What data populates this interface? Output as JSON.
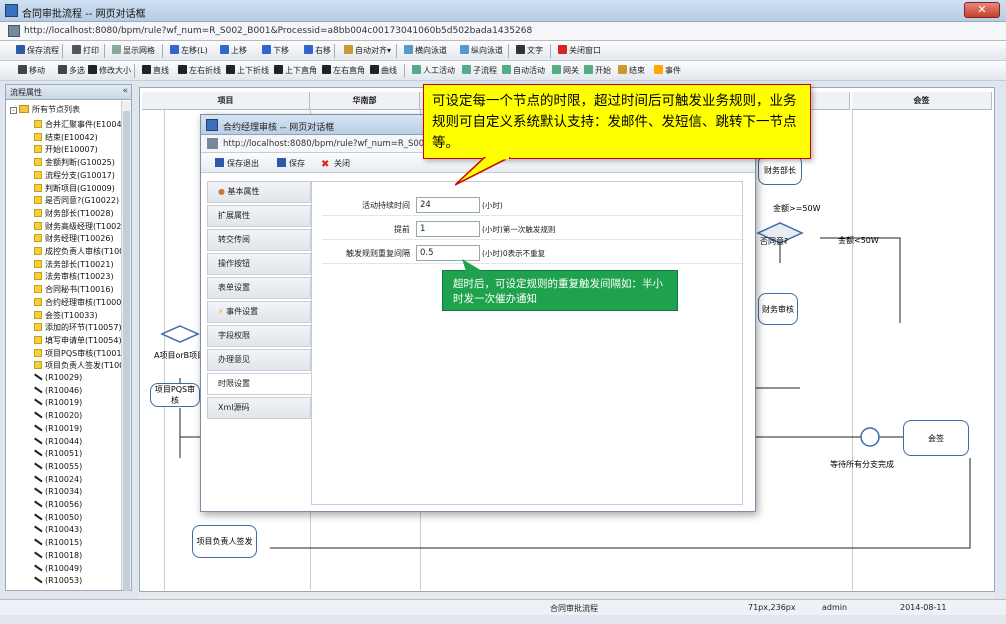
{
  "window": {
    "title": "合同审批流程 -- 网页对话框",
    "close": "✕",
    "url": "http://localhost:8080/bpm/rule?wf_num=R_S002_B001&Processid=a8bb004c00173041060b5d502bada1435268"
  },
  "toolbar1": [
    {
      "id": "save-flow",
      "label": "保存流程",
      "color": "#2d5aa8"
    },
    {
      "id": "print",
      "label": "打印",
      "color": "#555"
    },
    {
      "id": "show-grid",
      "label": "显示网格",
      "color": "#8a9"
    },
    {
      "id": "align-left",
      "label": "左移(L)",
      "color": "#36c"
    },
    {
      "id": "move-up",
      "label": "上移",
      "color": "#36c"
    },
    {
      "id": "move-down",
      "label": "下移",
      "color": "#36c"
    },
    {
      "id": "move-right",
      "label": "右移",
      "color": "#36c"
    },
    {
      "id": "auto-align",
      "label": "自动对齐▾",
      "color": "#c93"
    },
    {
      "id": "h-lane",
      "label": "横向泳道",
      "color": "#59c"
    },
    {
      "id": "v-lane",
      "label": "纵向泳道",
      "color": "#59c"
    },
    {
      "id": "text",
      "label": "文字",
      "color": "#333"
    },
    {
      "id": "close-window",
      "label": "关闭窗口",
      "color": "#d22"
    }
  ],
  "toolbar2": [
    {
      "id": "move",
      "label": "移动",
      "color": "#444"
    },
    {
      "id": "multi-select",
      "label": "多选",
      "color": "#444"
    },
    {
      "id": "resize",
      "label": "修改大小",
      "color": "#222"
    },
    {
      "id": "line",
      "label": "直线",
      "color": "#222"
    },
    {
      "id": "left-fold",
      "label": "左右折线",
      "color": "#222"
    },
    {
      "id": "ud-fold",
      "label": "上下折线",
      "color": "#222"
    },
    {
      "id": "ud-right",
      "label": "上下直角",
      "color": "#222"
    },
    {
      "id": "lr-right",
      "label": "左右直角",
      "color": "#222"
    },
    {
      "id": "curve",
      "label": "曲线",
      "color": "#222"
    },
    {
      "id": "manual-activity",
      "label": "人工活动",
      "color": "#5a8"
    },
    {
      "id": "sub-flow",
      "label": "子流程",
      "color": "#5a8"
    },
    {
      "id": "auto-activity",
      "label": "自动活动",
      "color": "#5a8"
    },
    {
      "id": "gateway",
      "label": "网关",
      "color": "#5a8"
    },
    {
      "id": "start",
      "label": "开始",
      "color": "#5a8"
    },
    {
      "id": "end",
      "label": "结束",
      "color": "#c93"
    },
    {
      "id": "event",
      "label": "事件",
      "color": "#fa0"
    }
  ],
  "left_panel": {
    "title": "流程属性",
    "collapse": "«",
    "root": "所有节点列表",
    "nodes": [
      {
        "t": "act",
        "label": "合并汇聚事件(E10045"
      },
      {
        "t": "act",
        "label": "结束(E10042)"
      },
      {
        "t": "act",
        "label": "开始(E10007)"
      },
      {
        "t": "act",
        "label": "金额判断(G10025)"
      },
      {
        "t": "act",
        "label": "流程分支(G10017)"
      },
      {
        "t": "act",
        "label": "判断项目(G10009)"
      },
      {
        "t": "act",
        "label": "是否同意?(G10022)"
      },
      {
        "t": "act",
        "label": "财务部长(T10028)"
      },
      {
        "t": "act",
        "label": "财务高级经理(T10027"
      },
      {
        "t": "act",
        "label": "财务经理(T10026)"
      },
      {
        "t": "act",
        "label": "成控负责人审核(T100"
      },
      {
        "t": "act",
        "label": "法务部长(T10021)"
      },
      {
        "t": "act",
        "label": "法务审核(T10023)"
      },
      {
        "t": "act",
        "label": "合同秘书(T10016)"
      },
      {
        "t": "act",
        "label": "合约经理审核(T10008"
      },
      {
        "t": "act",
        "label": "会签(T10033)"
      },
      {
        "t": "act",
        "label": "添加的环节(T10057)"
      },
      {
        "t": "act",
        "label": "填写申请单(T10054)"
      },
      {
        "t": "act",
        "label": "项目PQS审核(T10010"
      },
      {
        "t": "act",
        "label": "项目负责人签发(T100"
      },
      {
        "t": "rule",
        "label": "(R10029)"
      },
      {
        "t": "rule",
        "label": "(R10046)"
      },
      {
        "t": "rule",
        "label": "(R10019)"
      },
      {
        "t": "rule",
        "label": "(R10020)"
      },
      {
        "t": "rule",
        "label": "(R10019)"
      },
      {
        "t": "rule",
        "label": "(R10044)"
      },
      {
        "t": "rule",
        "label": "(R10051)"
      },
      {
        "t": "rule",
        "label": "(R10055)"
      },
      {
        "t": "rule",
        "label": "(R10024)"
      },
      {
        "t": "rule",
        "label": "(R10034)"
      },
      {
        "t": "rule",
        "label": "(R10056)"
      },
      {
        "t": "rule",
        "label": "(R10050)"
      },
      {
        "t": "rule",
        "label": "(R10043)"
      },
      {
        "t": "rule",
        "label": "(R10015)"
      },
      {
        "t": "rule",
        "label": "(R10018)"
      },
      {
        "t": "rule",
        "label": "(R10049)"
      },
      {
        "t": "rule",
        "label": "(R10053)"
      }
    ]
  },
  "canvas": {
    "lanes": [
      "项目",
      "华南部",
      "会签"
    ],
    "boxes": {
      "pqs": "项目PQS审核",
      "sign": "项目负责人签发",
      "countersign": "会签",
      "finance_head": "财务部长",
      "legal_review": "财务审核",
      "approve_q": "否同意?"
    },
    "labels": {
      "amount_ge": "金额>=50W",
      "amount_lt": "金额<50W",
      "wait_all": "等待所有分支完成",
      "ab_item": "A项目orB项目"
    }
  },
  "dialog": {
    "title": "合约经理审核 -- 网页对话框",
    "url": "http://localhost:8080/bpm/rule?wf_num=R_S002_B",
    "save_exit": "保存退出",
    "save": "保存",
    "close": "关闭",
    "tabs": [
      "基本属性",
      "扩展属性",
      "转交传阅",
      "操作按钮",
      "表单设置",
      "事件设置",
      "字段权限",
      "办理意见",
      "时限设置",
      "Xml源码"
    ],
    "fields": [
      {
        "label": "活动持续时间",
        "value": "24",
        "unit": "(小时)"
      },
      {
        "label": "提前",
        "value": "1",
        "unit": "(小时)第一次触发规则"
      },
      {
        "label": "触发规则重复间隔",
        "value": "0.5",
        "unit": "(小时)0表示不重复"
      }
    ]
  },
  "callouts": {
    "yellow": "可设定每一个节点的时限，超过时间后可触发业务规则，业务规则可自定义系统默认支持：发邮件、发短信、跳转下一节点等。",
    "green": "超时后，可设定规则的重复触发间隔如：半小时发一次催办通知"
  },
  "status": {
    "flow": "合同审批流程",
    "pos": "71px,236px",
    "user": "admin",
    "date": "2014-08-11"
  }
}
